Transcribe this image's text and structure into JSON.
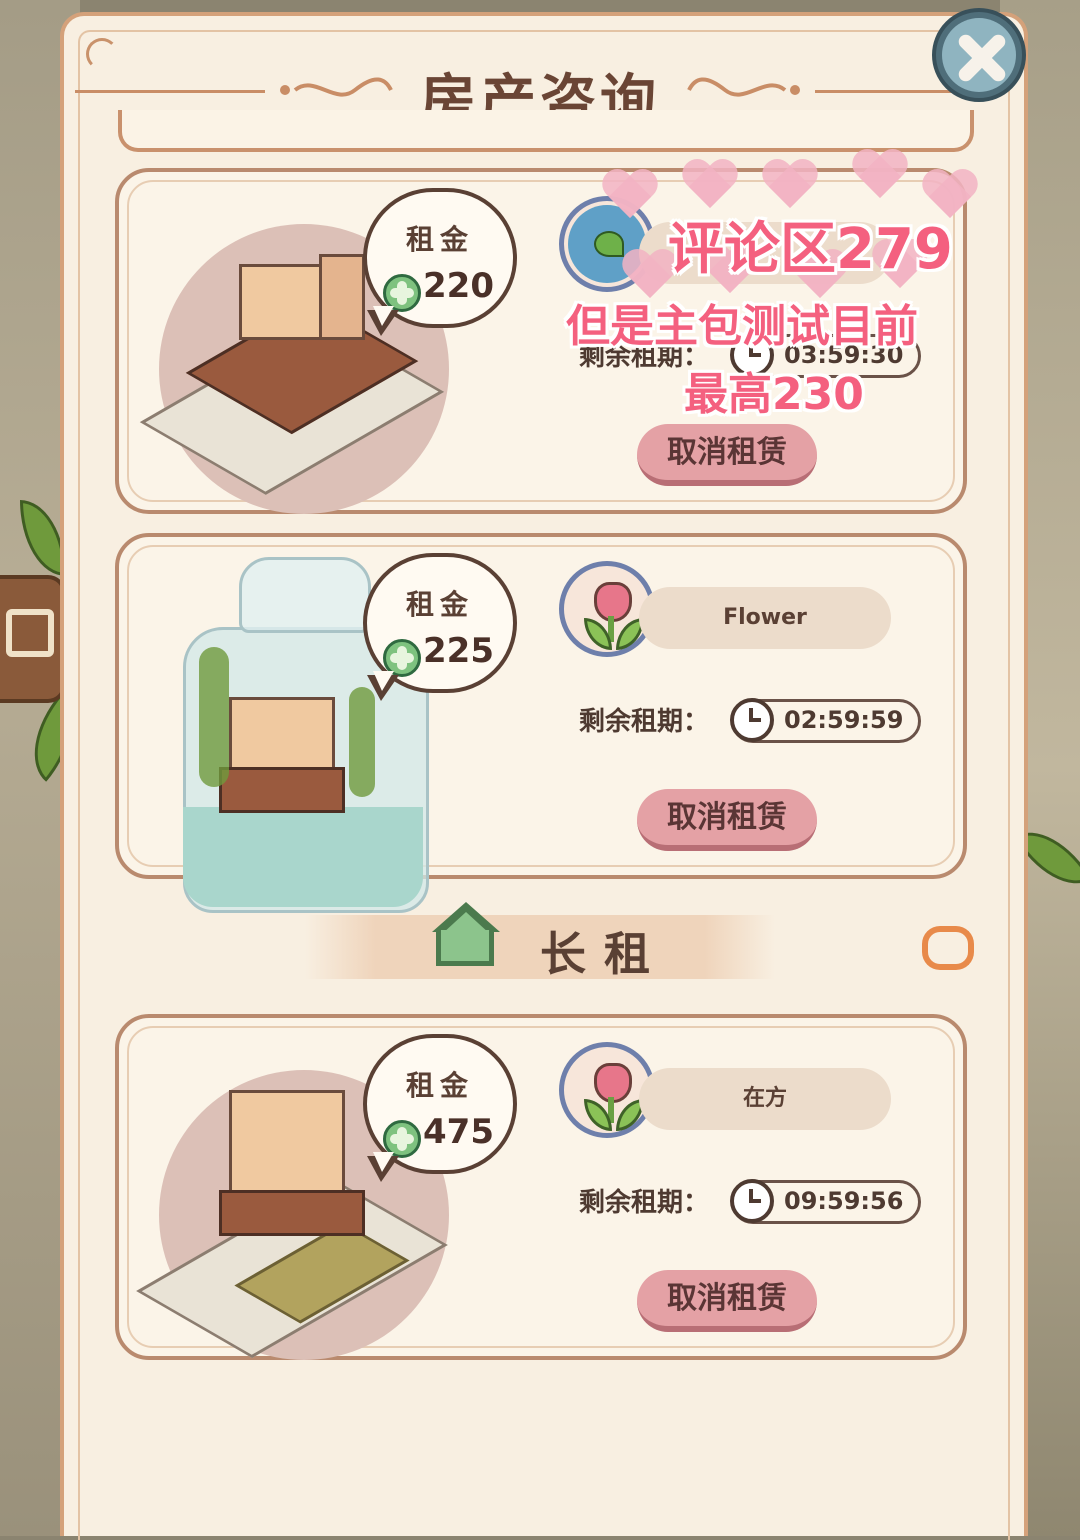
{
  "dialog": {
    "title": "房产咨询",
    "close_icon": "close-icon"
  },
  "rentals": [
    {
      "rent_label": "租金",
      "rent_amount": "220",
      "tenant_name": "",
      "tenant_avatar": "sprout-avatar",
      "period_label": "剩余租期：",
      "remaining": "03:59:30",
      "cancel_label": "取消租赁"
    },
    {
      "rent_label": "租金",
      "rent_amount": "225",
      "tenant_name": "Flower",
      "tenant_avatar": "tulip-avatar",
      "period_label": "剩余租期：",
      "remaining": "02:59:59",
      "cancel_label": "取消租赁"
    },
    {
      "rent_label": "租金",
      "rent_amount": "475",
      "tenant_name": "在方",
      "tenant_avatar": "tulip-avatar",
      "period_label": "剩余租期：",
      "remaining": "09:59:56",
      "cancel_label": "取消租赁"
    }
  ],
  "long_term_section": {
    "title": "长租",
    "icon": "house-icon",
    "refresh_icon": "refresh-icon"
  },
  "overlay": {
    "line1": "评论区279",
    "line2": "但是主包测试目前",
    "line3": "最高230"
  },
  "colors": {
    "panel_bg": "#f8efe1",
    "cancel_button": "#e4a1a5",
    "coin": "#7ec27f",
    "overlay_text": "#f4607f"
  }
}
